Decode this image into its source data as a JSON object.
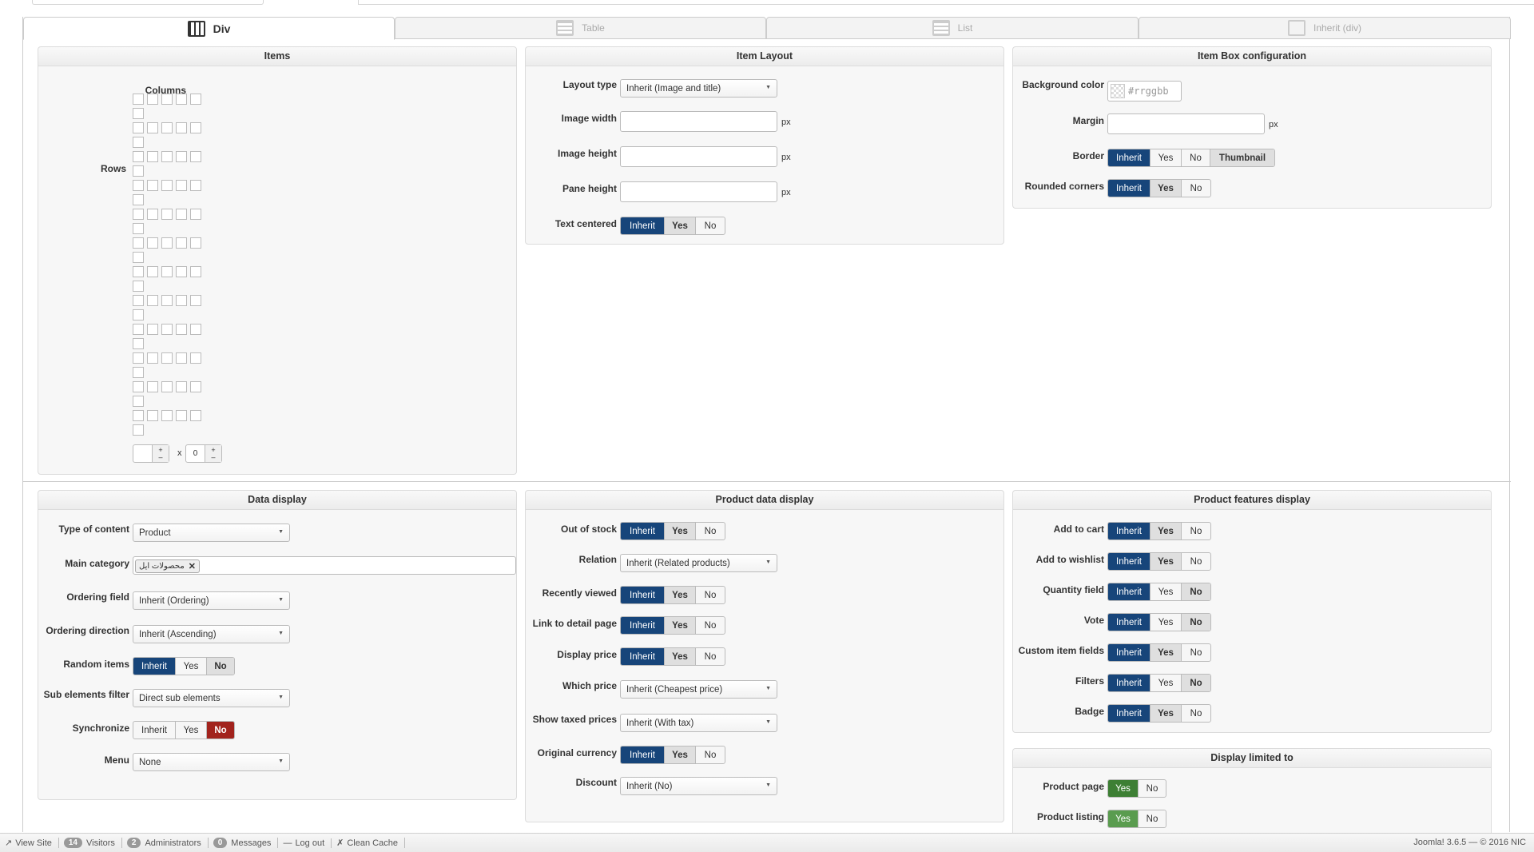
{
  "tabs": [
    {
      "label": "Div"
    },
    {
      "label": "Table"
    },
    {
      "label": "List"
    },
    {
      "label": "Inherit (div)"
    }
  ],
  "items": {
    "title": "Items",
    "columns_label": "Columns",
    "rows_label": "Rows",
    "x_sep": "x",
    "cols_value": "",
    "rows_value": "0",
    "plus": "+",
    "minus": "–"
  },
  "item_layout": {
    "title": "Item Layout",
    "layout_type_label": "Layout type",
    "layout_type_value": "Inherit (Image and title)",
    "image_width_label": "Image width",
    "image_height_label": "Image height",
    "pane_height_label": "Pane height",
    "px": "px",
    "text_centered_label": "Text centered"
  },
  "item_box": {
    "title": "Item Box configuration",
    "bg_color_label": "Background color",
    "bg_color_placeholder": "#rrggbb",
    "margin_label": "Margin",
    "border_label": "Border",
    "rounded_label": "Rounded corners",
    "thumbnail": "Thumbnail"
  },
  "opts": {
    "inherit": "Inherit",
    "yes": "Yes",
    "no": "No"
  },
  "data_display": {
    "title": "Data display",
    "type_label": "Type of content",
    "type_value": "Product",
    "main_cat_label": "Main category",
    "main_cat_tag": "محصولات ایل",
    "remove": "✕",
    "ordering_field_label": "Ordering field",
    "ordering_field_value": "Inherit (Ordering)",
    "ordering_dir_label": "Ordering direction",
    "ordering_dir_value": "Inherit (Ascending)",
    "random_label": "Random items",
    "sub_filter_label": "Sub elements filter",
    "sub_filter_value": "Direct sub elements",
    "sync_label": "Synchronize",
    "menu_label": "Menu",
    "menu_value": "None"
  },
  "product_data": {
    "title": "Product data display",
    "out_of_stock": "Out of stock",
    "relation": "Relation",
    "relation_value": "Inherit (Related products)",
    "recently_viewed": "Recently viewed",
    "link_detail": "Link to detail page",
    "display_price": "Display price",
    "which_price": "Which price",
    "which_price_value": "Inherit (Cheapest price)",
    "show_taxed": "Show taxed prices",
    "show_taxed_value": "Inherit (With tax)",
    "original_currency": "Original currency",
    "discount": "Discount",
    "discount_value": "Inherit (No)"
  },
  "features": {
    "title": "Product features display",
    "add_to_cart": "Add to cart",
    "add_to_wishlist": "Add to wishlist",
    "quantity_field": "Quantity field",
    "vote": "Vote",
    "custom_fields": "Custom item fields",
    "filters": "Filters",
    "badge": "Badge"
  },
  "limited": {
    "title": "Display limited to",
    "product_page": "Product page",
    "product_listing": "Product listing"
  },
  "footer": {
    "view_site": "View Site",
    "visitors_count": "14",
    "visitors": "Visitors",
    "admins_count": "2",
    "admins": "Administrators",
    "messages_count": "0",
    "messages": "Messages",
    "logout": "Log out",
    "clean_cache": "Clean Cache",
    "version": "Joomla! 3.6.5  —  © 2016 NIC"
  }
}
